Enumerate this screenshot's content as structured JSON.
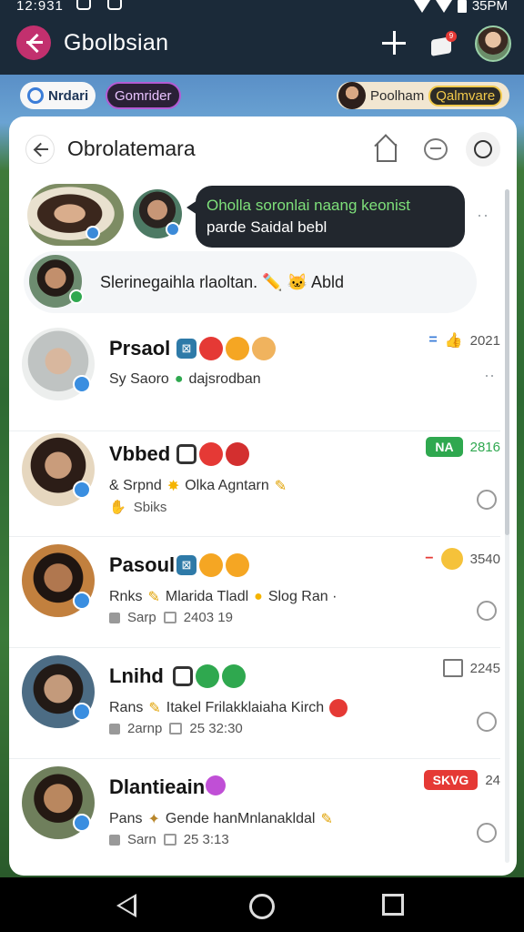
{
  "status_bar": {
    "time": "12:931",
    "right_text": "35PM"
  },
  "app_bar": {
    "title": "Gbolbsian",
    "notification_count": "9"
  },
  "chips": {
    "chip_a": "Nrdari",
    "chip_b": "Gomrider",
    "chip_c_name": "Poolham",
    "chip_c_badge": "Qalmvare"
  },
  "card": {
    "title": "Obrolatemara",
    "bubble_text": "Oholla soronlai naang keonist parde Saidal bebl",
    "bubble_highlight": "Oholla soronlai naang keonist",
    "bubble_rest": "parde Saidal bebl",
    "typing_text": "Slerinegaihla rlaoltan. ✏️ 🐱 Abld"
  },
  "chats": [
    {
      "name": "Prsaol",
      "line2": "Sy Saoro",
      "line2b": "dajsrodban",
      "line3": "",
      "time": "2021",
      "tag": "",
      "meta_icon": "thumbs-up-icon",
      "skin": "#d8b79e"
    },
    {
      "name": "Vbbed",
      "line2": "& Srpnd",
      "line2b": "Olka Agntarn",
      "line3": "Sbiks",
      "time": "2816",
      "tag": "NA",
      "tag_color": "#2fa84f",
      "skin": "#c99c7b"
    },
    {
      "name": "Pasoul",
      "line2": "Rnks",
      "line2b": "Mlarida Tladl",
      "line2c": "Slog Ran ·",
      "line3": "Sarp",
      "line3b": "2403 19",
      "time": "3540",
      "tag": "",
      "skin": "#b0774f"
    },
    {
      "name": "Lnihd",
      "line2": "Rans",
      "line2b": "Itakel Frilakklaiaha Kirch",
      "line3": "2arnp",
      "line3b": "25 32:30",
      "time": "2245",
      "tag": "",
      "skin": "#c39a7b"
    },
    {
      "name": "Dlantieain",
      "line2": "Pans",
      "line2b": "Gende hanMnlanakldal",
      "line3": "Sarn",
      "line3b": "25 3:13",
      "time": "24",
      "tag": "SKVG",
      "tag_color": "#e53935",
      "skin": "#b9875f"
    }
  ],
  "colors": {
    "accent_pink": "#c2306e",
    "bubble_bg": "#22272e",
    "bubble_highlight": "#7ee07a",
    "app_bar": "#1b2a39"
  }
}
